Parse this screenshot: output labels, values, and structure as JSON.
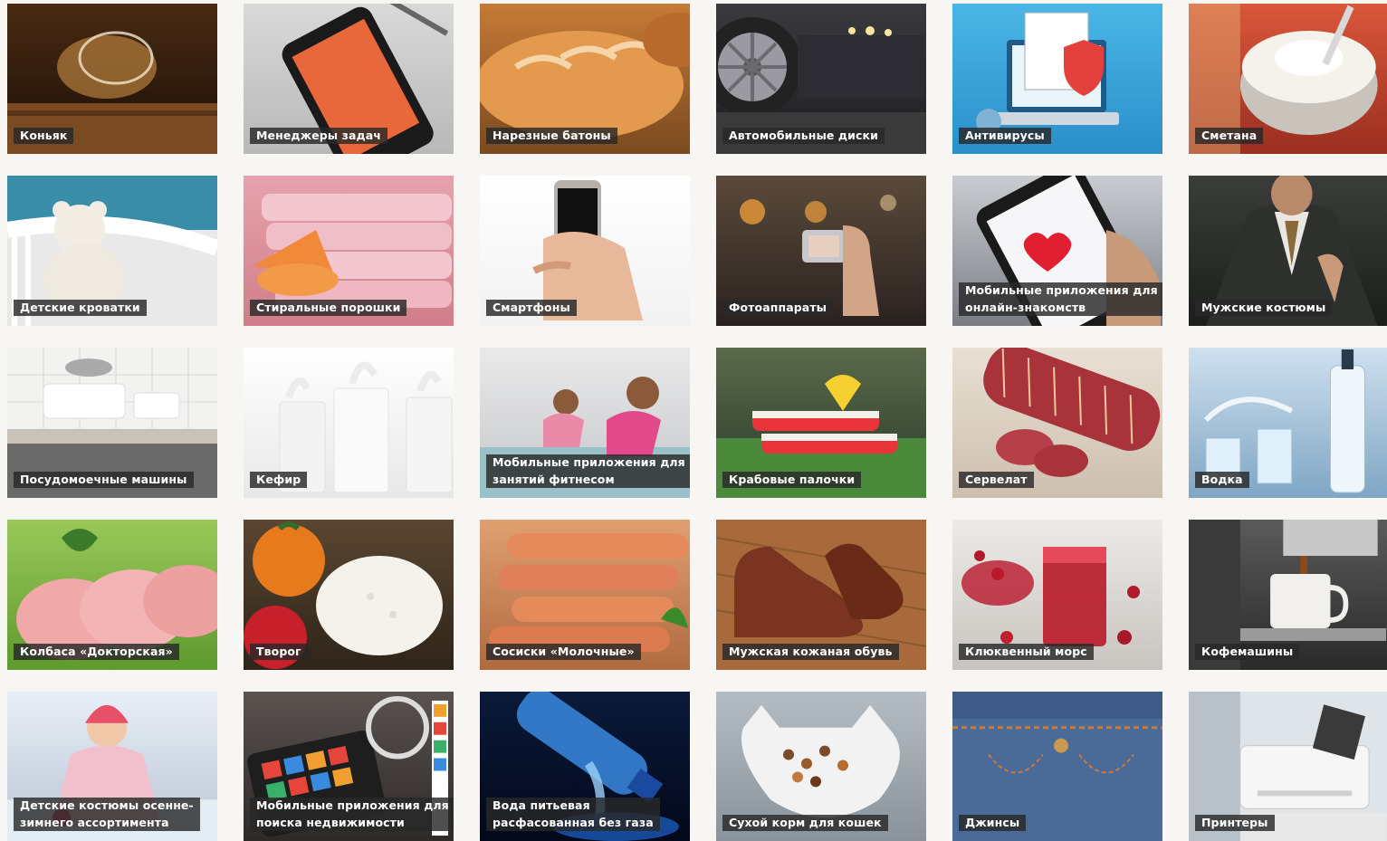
{
  "tiles": [
    {
      "name": "konyak",
      "lines": [
        "Коньяк"
      ],
      "bg": [
        "#4a2a12",
        "#1a0f08"
      ],
      "accent": "#d89a4a",
      "icon": "cognac-glass"
    },
    {
      "name": "task-managers",
      "lines": [
        "Менеджеры задач"
      ],
      "bg": [
        "#d9d9d9",
        "#b8b8b8"
      ],
      "accent": "#e34a3a",
      "icon": "smartphone"
    },
    {
      "name": "bread",
      "lines": [
        "Нарезные батоны"
      ],
      "bg": [
        "#c67a35",
        "#7a4a20"
      ],
      "accent": "#e39a4f",
      "icon": "bread"
    },
    {
      "name": "car-wheels",
      "lines": [
        "Автомобильные диски"
      ],
      "bg": [
        "#3a3a3e",
        "#1e1e22"
      ],
      "accent": "#8a8a90",
      "icon": "wheel"
    },
    {
      "name": "antivirus",
      "lines": [
        "Антивирусы"
      ],
      "bg": [
        "#4bb6e6",
        "#2b8fca"
      ],
      "accent": "#e4413c",
      "icon": "laptop-shield"
    },
    {
      "name": "sour-cream",
      "lines": [
        "Сметана"
      ],
      "bg": [
        "#d9573a",
        "#9a2e20"
      ],
      "accent": "#f4f2ea",
      "icon": "bowl"
    },
    {
      "name": "baby-cribs",
      "lines": [
        "Детские кроватки"
      ],
      "bg": [
        "#3a8da8",
        "#e8e8e8"
      ],
      "accent": "#f3f1ec",
      "icon": "teddy"
    },
    {
      "name": "washing-powders",
      "lines": [
        "Стиральные порошки"
      ],
      "bg": [
        "#e6a3ad",
        "#d07e89"
      ],
      "accent": "#f08a3a",
      "icon": "towels"
    },
    {
      "name": "smartphones",
      "lines": [
        "Смартфоны"
      ],
      "bg": [
        "#ffffff",
        "#f2f2f2"
      ],
      "accent": "#111111",
      "icon": "phone-hand"
    },
    {
      "name": "cameras",
      "lines": [
        "Фотоаппараты"
      ],
      "bg": [
        "#5a4a3a",
        "#2a2220"
      ],
      "accent": "#e89a3a",
      "icon": "camera"
    },
    {
      "name": "dating-apps",
      "lines": [
        "Мобильные приложения для",
        "онлайн-знакомств"
      ],
      "bg": [
        "#c9ccd0",
        "#7a7e84"
      ],
      "accent": "#e02030",
      "icon": "heart-phone"
    },
    {
      "name": "mens-suits",
      "lines": [
        "Мужские костюмы"
      ],
      "bg": [
        "#3a3d3a",
        "#1c1e1c"
      ],
      "accent": "#8a6a3a",
      "icon": "suit"
    },
    {
      "name": "dishwashers",
      "lines": [
        "Посудомоечные машины"
      ],
      "bg": [
        "#ededed",
        "#9a9a9a"
      ],
      "accent": "#ffffff",
      "icon": "dishes"
    },
    {
      "name": "kefir",
      "lines": [
        "Кефир"
      ],
      "bg": [
        "#ffffff",
        "#e8e8e8"
      ],
      "accent": "#f6f6f6",
      "icon": "milk"
    },
    {
      "name": "fitness-apps",
      "lines": [
        "Мобильные приложения для",
        "занятий фитнесом"
      ],
      "bg": [
        "#e9e9ea",
        "#c4c6c8"
      ],
      "accent": "#e24a8a",
      "icon": "fitness"
    },
    {
      "name": "crab-sticks",
      "lines": [
        "Крабовые палочки"
      ],
      "bg": [
        "#5a6a4a",
        "#2a3a2a"
      ],
      "accent": "#e8343a",
      "icon": "crab"
    },
    {
      "name": "servelat",
      "lines": [
        "Сервелат"
      ],
      "bg": [
        "#e8e0d4",
        "#cdbfae"
      ],
      "accent": "#a8333a",
      "icon": "sausage"
    },
    {
      "name": "vodka",
      "lines": [
        "Водка"
      ],
      "bg": [
        "#cfe0ee",
        "#7fa6c4"
      ],
      "accent": "#eef6fb",
      "icon": "bottle"
    },
    {
      "name": "doktorskaya",
      "lines": [
        "Колбаса «Докторская»"
      ],
      "bg": [
        "#9ac85a",
        "#5e9a2e"
      ],
      "accent": "#f0a8a8",
      "icon": "slices"
    },
    {
      "name": "tvorog",
      "lines": [
        "Творог"
      ],
      "bg": [
        "#5a4632",
        "#2e2418"
      ],
      "accent": "#f4f2ea",
      "icon": "cottage"
    },
    {
      "name": "sausages-milk",
      "lines": [
        "Сосиски «Молочные»"
      ],
      "bg": [
        "#e0a070",
        "#b06a40"
      ],
      "accent": "#e58a5a",
      "icon": "hotdogs"
    },
    {
      "name": "mens-leather-shoes",
      "lines": [
        "Мужская кожаная обувь"
      ],
      "bg": [
        "#a86a3a",
        "#6a3a1e"
      ],
      "accent": "#7a3420",
      "icon": "shoes"
    },
    {
      "name": "cranberry-mors",
      "lines": [
        "Клюквенный морс"
      ],
      "bg": [
        "#ecebe8",
        "#c8c4c0"
      ],
      "accent": "#b81a2a",
      "icon": "glass-berries"
    },
    {
      "name": "coffee-machines",
      "lines": [
        "Кофемашины"
      ],
      "bg": [
        "#5a5a5a",
        "#2a2a2a"
      ],
      "accent": "#f2f0ec",
      "icon": "cup"
    },
    {
      "name": "kids-winter-suits",
      "lines": [
        "Детские костюмы осенне-",
        "зимнего ассортимента"
      ],
      "bg": [
        "#e8eef6",
        "#b8c4d4"
      ],
      "accent": "#e8506a",
      "icon": "child"
    },
    {
      "name": "real-estate-apps",
      "lines": [
        "Мобильные приложения для",
        "поиска недвижимости"
      ],
      "bg": [
        "#5a5350",
        "#2e2a28"
      ],
      "accent": "#e5453a",
      "icon": "tablet-apps"
    },
    {
      "name": "bottled-water",
      "lines": [
        "Вода питьевая",
        "расфасованная без газа"
      ],
      "bg": [
        "#0a1a3a",
        "#03081a"
      ],
      "accent": "#3a8ae0",
      "icon": "water-bottle"
    },
    {
      "name": "cat-food",
      "lines": [
        "Сухой корм для кошек"
      ],
      "bg": [
        "#b4bcc4",
        "#8a929a"
      ],
      "accent": "#7a4a2a",
      "icon": "cat-bowl"
    },
    {
      "name": "jeans",
      "lines": [
        "Джинсы"
      ],
      "bg": [
        "#5a7aa6",
        "#2e4a72"
      ],
      "accent": "#c87a3a",
      "icon": "jeans"
    },
    {
      "name": "printers",
      "lines": [
        "Принтеры"
      ],
      "bg": [
        "#e8ecef",
        "#b0b8c0"
      ],
      "accent": "#3a3a3a",
      "icon": "printer"
    }
  ]
}
